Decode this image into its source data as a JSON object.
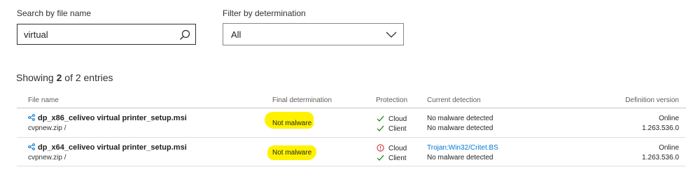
{
  "search": {
    "label": "Search by file name",
    "value": "virtual",
    "icon": "search-icon"
  },
  "filter": {
    "label": "Filter by determination",
    "selected": "All",
    "icon": "chevron-down-icon"
  },
  "summary": {
    "prefix": "Showing ",
    "shown": "2",
    "suffix": " of 2 entries"
  },
  "columns": {
    "file_name": "File name",
    "final_determination": "Final determination",
    "protection": "Protection",
    "current_detection": "Current detection",
    "definition_version": "Definition version"
  },
  "rows": [
    {
      "file_name": "dp_x86_celiveo virtual printer_setup.msi",
      "path": "cvpnew.zip /",
      "final_determination": "Not malware",
      "protection": [
        {
          "channel": "Cloud",
          "status": "ok",
          "detection": "No malware detected"
        },
        {
          "channel": "Client",
          "status": "ok",
          "detection": "No malware detected"
        }
      ],
      "definition": {
        "line1": "Online",
        "line2": "1.263.536.0"
      }
    },
    {
      "file_name": "dp_x64_celiveo virtual printer_setup.msi",
      "path": "cvpnew.zip /",
      "final_determination": "Not malware",
      "protection": [
        {
          "channel": "Cloud",
          "status": "alert",
          "detection": "Trojan:Win32/Critet.BS"
        },
        {
          "channel": "Client",
          "status": "ok",
          "detection": "No malware detected"
        }
      ],
      "definition": {
        "line1": "Online",
        "line2": "1.263.536.0"
      }
    }
  ],
  "colors": {
    "ok": "#107c10",
    "alert": "#d13438",
    "link": "#0078d4",
    "highlight": "#fff200"
  }
}
